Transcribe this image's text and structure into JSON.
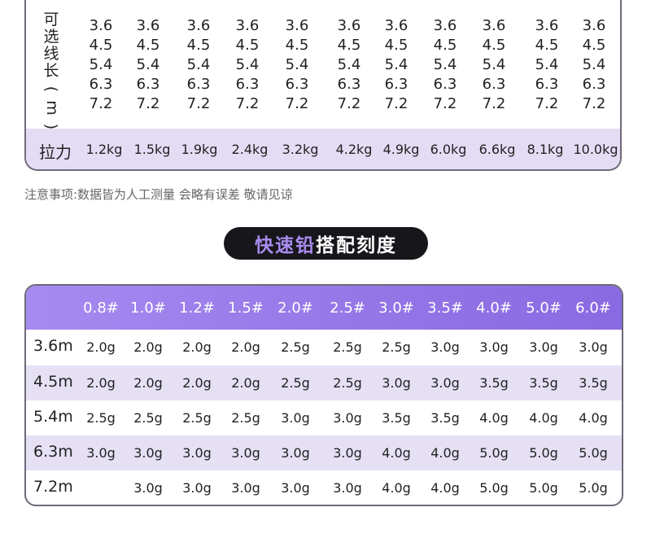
{
  "length_table": {
    "vertical_label": [
      "可",
      "选",
      "线",
      "长",
      "(",
      "m",
      ")"
    ],
    "lengths": [
      "3.6",
      "4.5",
      "5.4",
      "6.3",
      "7.2"
    ],
    "column_count": 11,
    "tension_label": "拉力",
    "tension_values": [
      "1.2kg",
      "1.5kg",
      "1.9kg",
      "2.4kg",
      "3.2kg",
      "4.2kg",
      "4.9kg",
      "6.0kg",
      "6.6kg",
      "8.1kg",
      "10.0kg"
    ]
  },
  "note": "注意事项:数据皆为人工测量 会略有误差 敬请见谅",
  "section_title": {
    "accent": "快速铅",
    "main": "搭配刻度"
  },
  "weight_table": {
    "headers": [
      "0.8#",
      "1.0#",
      "1.2#",
      "1.5#",
      "2.0#",
      "2.5#",
      "3.0#",
      "3.5#",
      "4.0#",
      "5.0#",
      "6.0#"
    ],
    "rows": [
      {
        "label": "3.6m",
        "cells": [
          "2.0g",
          "2.0g",
          "2.0g",
          "2.0g",
          "2.5g",
          "2.5g",
          "2.5g",
          "3.0g",
          "3.0g",
          "3.0g",
          "3.0g"
        ]
      },
      {
        "label": "4.5m",
        "cells": [
          "2.0g",
          "2.0g",
          "2.0g",
          "2.0g",
          "2.5g",
          "2.5g",
          "3.0g",
          "3.0g",
          "3.5g",
          "3.5g",
          "3.5g"
        ]
      },
      {
        "label": "5.4m",
        "cells": [
          "2.5g",
          "2.5g",
          "2.5g",
          "2.5g",
          "3.0g",
          "3.0g",
          "3.5g",
          "3.5g",
          "4.0g",
          "4.0g",
          "4.0g"
        ]
      },
      {
        "label": "6.3m",
        "cells": [
          "3.0g",
          "3.0g",
          "3.0g",
          "3.0g",
          "3.0g",
          "3.0g",
          "4.0g",
          "4.0g",
          "5.0g",
          "5.0g",
          "5.0g"
        ]
      },
      {
        "label": "7.2m",
        "cells": [
          "",
          "3.0g",
          "3.0g",
          "3.0g",
          "3.0g",
          "3.0g",
          "4.0g",
          "4.0g",
          "5.0g",
          "5.0g",
          "5.0g"
        ]
      }
    ]
  },
  "colors": {
    "header_purple": "#9a7eea",
    "band_lavender": "#e3dcf4",
    "pill_black": "#17161b",
    "pill_accent": "#a98cf0"
  }
}
